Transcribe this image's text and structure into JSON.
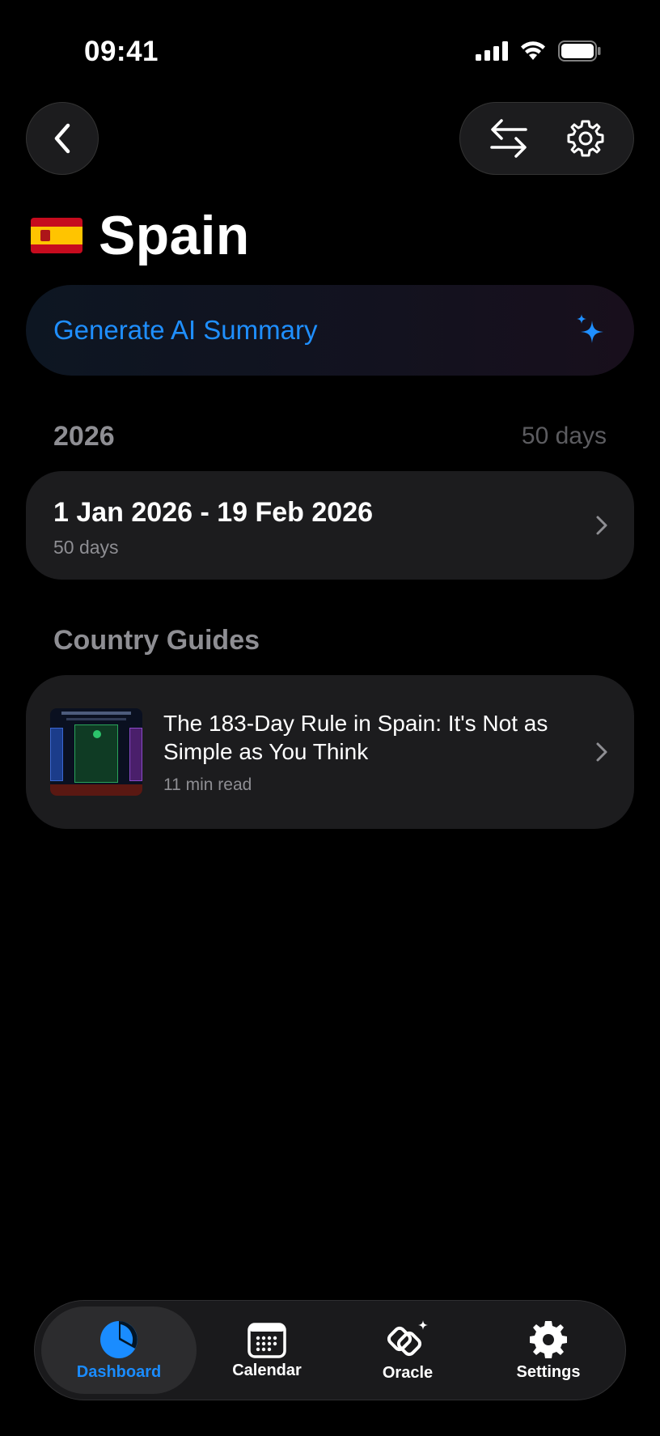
{
  "status": {
    "time": "09:41"
  },
  "header": {
    "title": "Spain",
    "flag": "spain-flag"
  },
  "ai_summary": {
    "label": "Generate AI Summary",
    "accent": "#1f8fff"
  },
  "year_section": {
    "year": "2026",
    "total": "50 days"
  },
  "range": {
    "title": "1 Jan 2026 - 19 Feb 2026",
    "subtitle": "50 days"
  },
  "guides": {
    "heading": "Country Guides",
    "items": [
      {
        "title": "The 183-Day Rule in Spain: It's Not as Simple as You Think",
        "meta": "11 min read"
      }
    ]
  },
  "tabbar": {
    "active": "Dashboard",
    "tabs": [
      {
        "label": "Dashboard",
        "icon": "pie-chart-icon"
      },
      {
        "label": "Calendar",
        "icon": "calendar-icon"
      },
      {
        "label": "Oracle",
        "icon": "oracle-icon"
      },
      {
        "label": "Settings",
        "icon": "gear-icon"
      }
    ]
  }
}
